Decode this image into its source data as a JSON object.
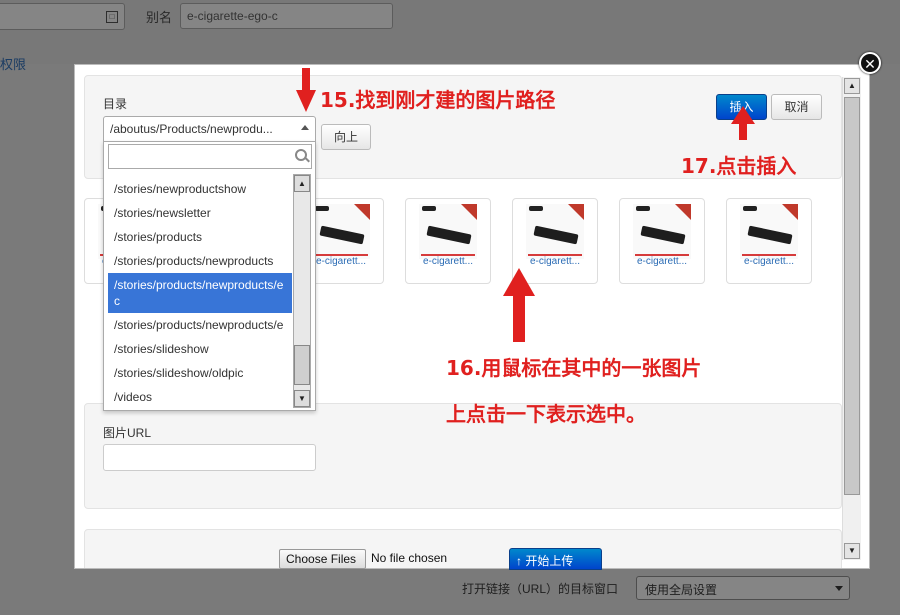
{
  "background": {
    "alias_label": "别名",
    "alias_value": "e-cigarette-ego-c",
    "permissions_link": "权限",
    "link_target_label": "打开链接（URL）的目标窗口",
    "link_target_select": "使用全局设置",
    "field_icon": "□"
  },
  "modal": {
    "close_glyph": "✕",
    "directory_label": "目录",
    "directory_value": "/aboutus/Products/newprodu...",
    "up_button": "向上",
    "insert_button": "插入",
    "cancel_button": "取消",
    "image_url_label": "图片URL",
    "image_url_value": "",
    "search_value": "",
    "dropdown_items": [
      {
        "label": "/stories/newproductshow",
        "selected": false
      },
      {
        "label": "/stories/newsletter",
        "selected": false
      },
      {
        "label": "/stories/products",
        "selected": false
      },
      {
        "label": "/stories/products/newproducts",
        "selected": false
      },
      {
        "label": "/stories/products/newproducts/ec",
        "selected": true
      },
      {
        "label": "/stories/products/newproducts/e",
        "selected": false
      },
      {
        "label": "/stories/slideshow",
        "selected": false
      },
      {
        "label": "/stories/slideshow/oldpic",
        "selected": false
      },
      {
        "label": "/videos",
        "selected": false
      }
    ],
    "thumbnails": [
      {
        "caption": "e-cigarett..."
      },
      {
        "caption": "e-cigarett..."
      },
      {
        "caption": "e-cigarett..."
      },
      {
        "caption": "e-cigarett..."
      },
      {
        "caption": "e-cigarett..."
      },
      {
        "caption": "e-cigarett..."
      },
      {
        "caption": "e-cigarett..."
      }
    ],
    "choose_file_button": "Choose Files",
    "no_file_text": "No file chosen",
    "upload_button": "↑ 开始上传"
  },
  "annotations": {
    "step15": "15.找到刚才建的图片路径",
    "step16_line1": "16.用鼠标在其中的一张图片",
    "step16_line2": "上点击一下表示选中。",
    "step17": "17.点击插入"
  },
  "colors": {
    "annotation_red": "#e0201f",
    "primary_blue": "#0055cc",
    "selected_item": "#3875d7",
    "overlay": "#7a7a7a"
  }
}
